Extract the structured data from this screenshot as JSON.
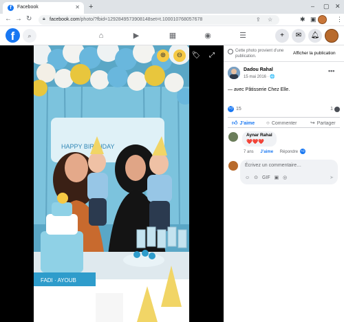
{
  "browser": {
    "tab_title": "Facebook",
    "tab_close": "✕",
    "new_tab": "+",
    "url_host": "facebook.com",
    "url_path": "/photo/?fbid=1292849573908148set=t.100010768057678",
    "icons": [
      "back-icon",
      "forward-icon",
      "reload-icon",
      "lock-icon",
      "share-icon",
      "star-icon",
      "extensions-icon",
      "sidepanel-icon",
      "profile-icon",
      "menu-icon"
    ],
    "window_controls": [
      "–",
      "▢",
      "✕"
    ]
  },
  "facebook": {
    "logo": "f",
    "nav_icons": [
      "home-icon",
      "watch-icon",
      "marketplace-icon",
      "groups-icon",
      "menu-icon"
    ],
    "right_icons": [
      "create-icon",
      "messenger-icon",
      "notifications-icon",
      "account-icon"
    ],
    "brand_color": "#1877f2"
  },
  "viewer": {
    "icons": [
      "zoom-in-icon",
      "zoom-out-icon",
      "tag-icon",
      "fullscreen-icon"
    ],
    "cake_label": "FADI · AYOUB"
  },
  "panel": {
    "notice_text": "Cette photo provient d’une publication.",
    "notice_link": "Afficher la publication",
    "author": "Dadou Rahal",
    "date": "15 mai 2016 · ",
    "date_icon": "🌐",
    "caption": "— avec Pâtisserie Chez Elle.",
    "reaction_count": "15",
    "comment_count": "1",
    "actions": {
      "like": "J’aime",
      "comment": "Commenter",
      "share": "Partager"
    },
    "comment": {
      "name": "Aynar Rahal",
      "text": "❤️❤️❤️",
      "age": "7 ans",
      "like": "J’aime",
      "reply": "Répondre"
    },
    "composer": {
      "placeholder": "Écrivez un commentaire…",
      "tools": [
        "☺",
        "⊙",
        "GIF",
        "▣",
        "◎"
      ],
      "send": "➤"
    }
  }
}
